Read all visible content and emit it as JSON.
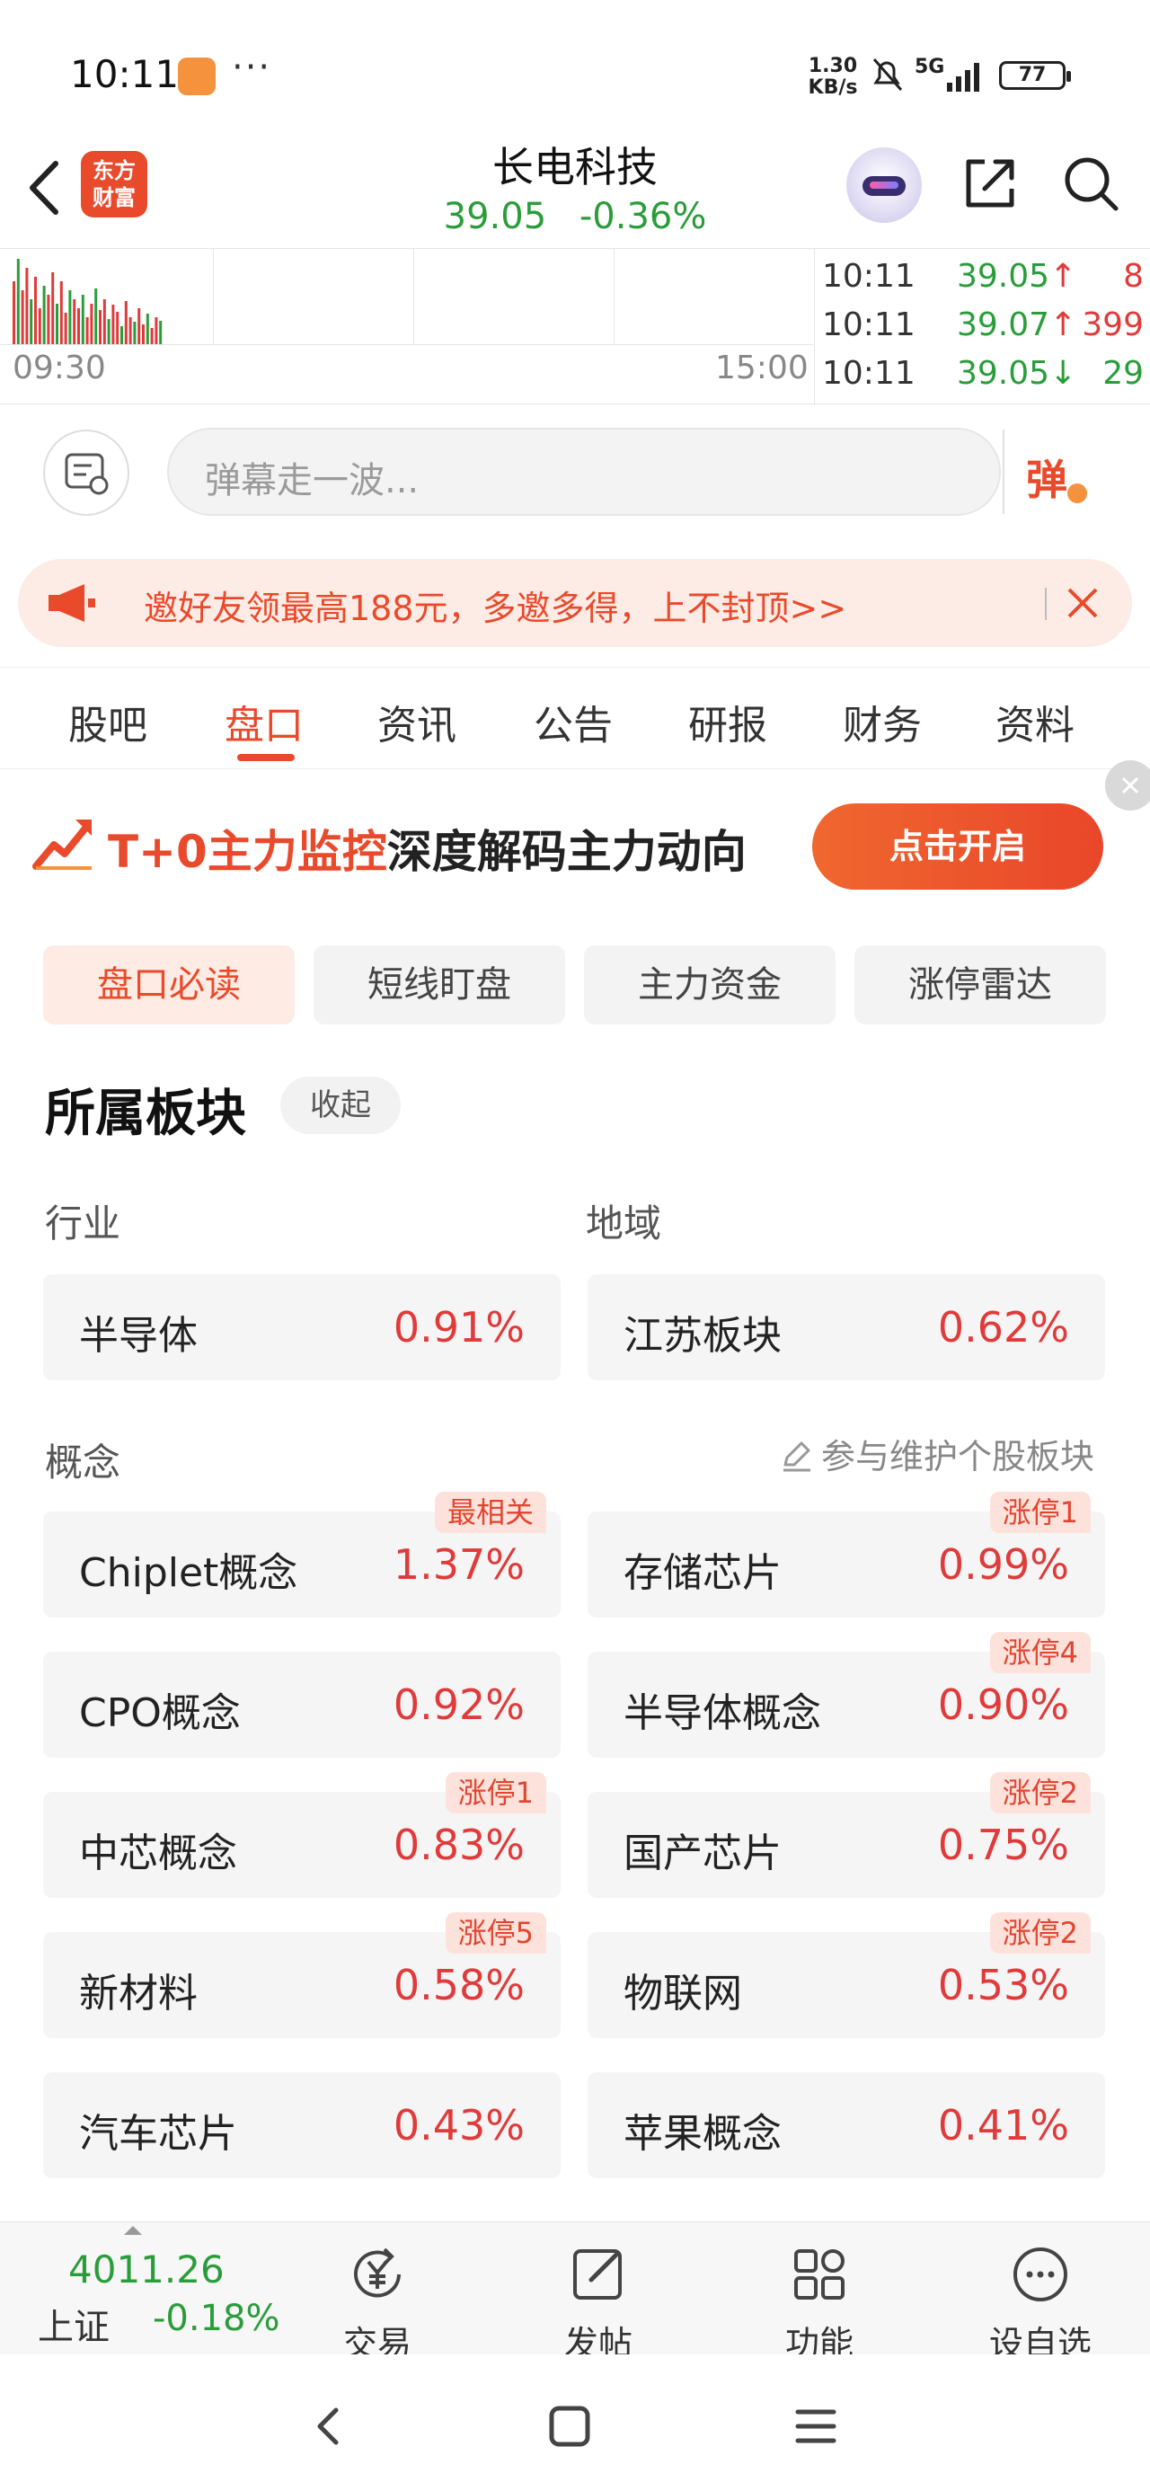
{
  "status_bar": {
    "time": "10:11",
    "dots": "···",
    "net_speed_value": "1.30",
    "net_speed_unit": "KB/s",
    "network": "5G",
    "battery": "77"
  },
  "header": {
    "logo_line1": "东方",
    "logo_line2": "财富",
    "stock_name": "长电科技",
    "price": "39.05",
    "change_pct": "-0.36%",
    "price_color": "#2a9d3a"
  },
  "mini_chart": {
    "start_time": "09:30",
    "end_time": "15:00"
  },
  "ticks": [
    {
      "time": "10:11",
      "price": "39.05",
      "arrow": "↑",
      "arrow_dir": "up",
      "volume": "8",
      "volume_color": "red"
    },
    {
      "time": "10:11",
      "price": "39.07",
      "arrow": "↑",
      "arrow_dir": "up",
      "volume": "399",
      "volume_color": "red"
    },
    {
      "time": "10:11",
      "price": "39.05",
      "arrow": "↓",
      "arrow_dir": "down",
      "volume": "29",
      "volume_color": "green"
    }
  ],
  "danmu": {
    "placeholder": "弹幕走一波...",
    "send_label": "弹"
  },
  "promo_banner": {
    "text": "邀好友领最高188元，多邀多得，上不封顶>>"
  },
  "tabs": [
    {
      "label": "股吧"
    },
    {
      "label": "盘口",
      "active": true
    },
    {
      "label": "资讯"
    },
    {
      "label": "公告"
    },
    {
      "label": "研报"
    },
    {
      "label": "财务"
    },
    {
      "label": "资料"
    }
  ],
  "t0_banner": {
    "highlight": "T+0主力监控",
    "text": "深度解码主力动向",
    "button": "点击开启"
  },
  "sub_tabs": [
    {
      "label": "盘口必读",
      "active": true
    },
    {
      "label": "短线盯盘"
    },
    {
      "label": "主力资金"
    },
    {
      "label": "涨停雷达"
    }
  ],
  "sectors": {
    "title": "所属板块",
    "collapse_label": "收起",
    "industry_label": "行业",
    "region_label": "地域",
    "concept_label": "概念",
    "maintain_label": "参与维护个股板块",
    "industry": {
      "name": "半导体",
      "pct": "0.91%"
    },
    "region": {
      "name": "江苏板块",
      "pct": "0.62%"
    },
    "concepts": [
      {
        "name": "Chiplet概念",
        "pct": "1.37%",
        "tag": "最相关"
      },
      {
        "name": "存储芯片",
        "pct": "0.99%",
        "tag": "涨停1"
      },
      {
        "name": "CPO概念",
        "pct": "0.92%",
        "tag": ""
      },
      {
        "name": "半导体概念",
        "pct": "0.90%",
        "tag": "涨停4"
      },
      {
        "name": "中芯概念",
        "pct": "0.83%",
        "tag": "涨停1"
      },
      {
        "name": "国产芯片",
        "pct": "0.75%",
        "tag": "涨停2"
      },
      {
        "name": "新材料",
        "pct": "0.58%",
        "tag": "涨停5"
      },
      {
        "name": "物联网",
        "pct": "0.53%",
        "tag": "涨停2"
      },
      {
        "name": "汽车芯片",
        "pct": "0.43%",
        "tag": ""
      },
      {
        "name": "苹果概念",
        "pct": "0.41%",
        "tag": ""
      }
    ]
  },
  "bottom_bar": {
    "index_value": "4011.26",
    "index_name": "上证",
    "index_change": "-0.18%",
    "items": [
      {
        "label": "交易",
        "icon": "yen-exchange-icon"
      },
      {
        "label": "发帖",
        "icon": "edit-post-icon"
      },
      {
        "label": "功能",
        "icon": "grid-apps-icon"
      },
      {
        "label": "设自选",
        "icon": "more-circle-icon"
      }
    ]
  },
  "colors": {
    "accent": "#e94a2b",
    "up": "#e03a3a",
    "down": "#2a9d3a"
  }
}
